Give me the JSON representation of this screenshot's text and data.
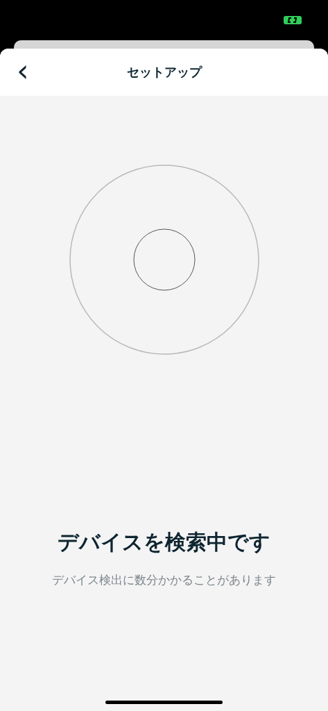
{
  "header": {
    "back": "‹",
    "title": "セットアップ"
  },
  "status": {
    "title": "デバイスを検索中です",
    "subtitle": "デバイス検出に数分かかることがあります"
  }
}
